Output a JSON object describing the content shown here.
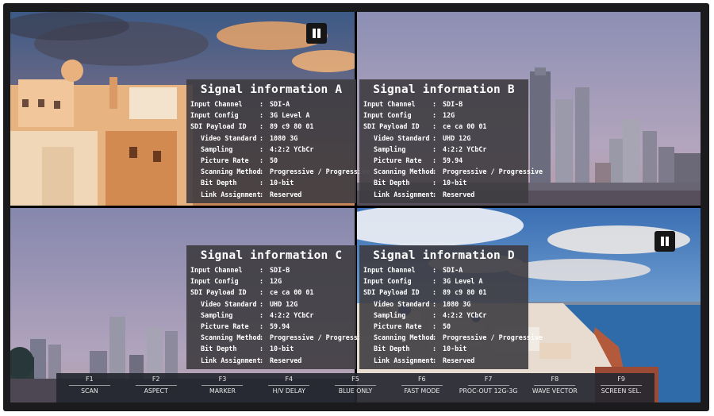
{
  "panels": [
    {
      "title": "Signal information A",
      "rows": [
        {
          "label": "Input Channel",
          "sep": ":",
          "value": "SDI-A"
        },
        {
          "label": "Input Config",
          "sep": ":",
          "value": "3G Level A"
        },
        {
          "label": "SDI Payload ID",
          "sep": ":",
          "value": "89 c9 80 01"
        },
        {
          "label": "Video Standard",
          "sep": ":",
          "value": "1080 3G"
        },
        {
          "label": "Sampling",
          "sep": ":",
          "value": "4:2:2 YCbCr"
        },
        {
          "label": "Picture Rate",
          "sep": ":",
          "value": "50"
        },
        {
          "label": "Scanning Method",
          "sep": ":",
          "value": "Progressive / Progressive"
        },
        {
          "label": "Bit Depth",
          "sep": ":",
          "value": "10-bit"
        },
        {
          "label": "Link Assignment",
          "sep": ":",
          "value": "Reserved"
        }
      ]
    },
    {
      "title": "Signal information B",
      "rows": [
        {
          "label": "Input Channel",
          "sep": ":",
          "value": "SDI-B"
        },
        {
          "label": "Input Config",
          "sep": ":",
          "value": "12G"
        },
        {
          "label": "SDI Payload ID",
          "sep": ":",
          "value": "ce ca 00 01"
        },
        {
          "label": "Video Standard",
          "sep": ":",
          "value": "UHD 12G"
        },
        {
          "label": "Sampling",
          "sep": ":",
          "value": "4:2:2 YCbCr"
        },
        {
          "label": "Picture Rate",
          "sep": ":",
          "value": "59.94"
        },
        {
          "label": "Scanning Method",
          "sep": ":",
          "value": "Progressive / Progressive"
        },
        {
          "label": "Bit Depth",
          "sep": ":",
          "value": "10-bit"
        },
        {
          "label": "Link Assignment",
          "sep": ":",
          "value": "Reserved"
        }
      ]
    },
    {
      "title": "Signal information C",
      "rows": [
        {
          "label": "Input Channel",
          "sep": ":",
          "value": "SDI-B"
        },
        {
          "label": "Input Config",
          "sep": ":",
          "value": "12G"
        },
        {
          "label": "SDI Payload ID",
          "sep": ":",
          "value": "ce ca 00 01"
        },
        {
          "label": "Video Standard",
          "sep": ":",
          "value": "UHD 12G"
        },
        {
          "label": "Sampling",
          "sep": ":",
          "value": "4:2:2 YCbCr"
        },
        {
          "label": "Picture Rate",
          "sep": ":",
          "value": "59.94"
        },
        {
          "label": "Scanning Method",
          "sep": ":",
          "value": "Progressive / Progressive"
        },
        {
          "label": "Bit Depth",
          "sep": ":",
          "value": "10-bit"
        },
        {
          "label": "Link Assignment",
          "sep": ":",
          "value": "Reserved"
        }
      ]
    },
    {
      "title": "Signal information D",
      "rows": [
        {
          "label": "Input Channel",
          "sep": ":",
          "value": "SDI-A"
        },
        {
          "label": "Input Config",
          "sep": ":",
          "value": "3G Level A"
        },
        {
          "label": "SDI Payload ID",
          "sep": ":",
          "value": "89 c9 80 01"
        },
        {
          "label": "Video Standard",
          "sep": ":",
          "value": "1080 3G"
        },
        {
          "label": "Sampling",
          "sep": ":",
          "value": "4:2:2 YCbCr"
        },
        {
          "label": "Picture Rate",
          "sep": ":",
          "value": "50"
        },
        {
          "label": "Scanning Method",
          "sep": ":",
          "value": "Progressive / Progressive"
        },
        {
          "label": "Bit Depth",
          "sep": ":",
          "value": "10-bit"
        },
        {
          "label": "Link Assignment",
          "sep": ":",
          "value": "Reserved"
        }
      ]
    }
  ],
  "function_keys": [
    {
      "key": "F1",
      "label": "SCAN"
    },
    {
      "key": "F2",
      "label": "ASPECT"
    },
    {
      "key": "F3",
      "label": "MARKER"
    },
    {
      "key": "F4",
      "label": "H/V DELAY"
    },
    {
      "key": "F5",
      "label": "BLUE ONLY"
    },
    {
      "key": "F6",
      "label": "FAST MODE"
    },
    {
      "key": "F7",
      "label": "PROC-OUT 12G-3G"
    },
    {
      "key": "F8",
      "label": "WAVE VECTOR"
    },
    {
      "key": "F9",
      "label": "SCREEN SEL."
    }
  ],
  "icons": {
    "pause_a": "pause-icon",
    "pause_d": "pause-icon"
  },
  "colors": {
    "panel_bg": "#3e3c40",
    "function_bar_bg": "#262830",
    "bezel": "#1b1b1d"
  }
}
